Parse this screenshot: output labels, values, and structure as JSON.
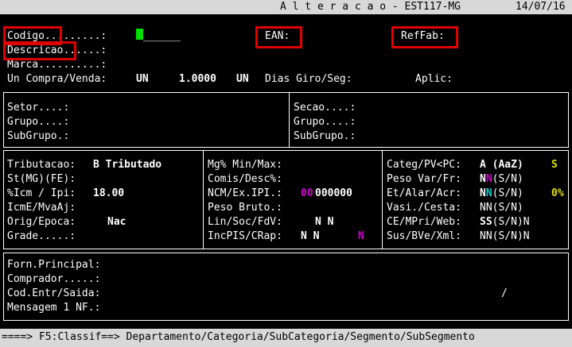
{
  "header": {
    "title": "A l t e r a c a o - EST117-MG",
    "date": "14/07/16"
  },
  "identification": {
    "codigo_label": "Codigo.........:",
    "codigo_input": "______",
    "ean_label": "EAN:",
    "reffab_label": "RefFab:",
    "descricao_label": "Descricao......:",
    "marca_label": "Marca..........:",
    "un_label": "Un Compra/Venda:",
    "un_compra": "UN",
    "fator": "1.0000",
    "un_venda": "UN",
    "dias_giro_label": "Dias Giro/Seg:",
    "aplic_label": "Aplic:"
  },
  "classification": {
    "setor": "Setor....:",
    "grupo": "Grupo....:",
    "subgrupo": "SubGrupo.:",
    "secao": "Secao....:",
    "grupo_right": "Grupo....:",
    "subgrupo_right": "SubGrupo.:"
  },
  "tax": {
    "tributacao_label": "Tributacao:",
    "tributacao_value": "B Tributado",
    "st_label": "St(MG)(FE):",
    "icm_label": "%Icm / Ipi:",
    "icm_value": "18.00",
    "icme_label": "IcmE/MvaAj:",
    "orig_label": "Orig/Epoca:",
    "orig_value": "Nac",
    "grade_label": "Grade.....:"
  },
  "pricing": {
    "mg_label": "Mg% Min/Max:",
    "comis_label": "Comis/Desc%:",
    "ncm_label": "NCM/Ex.IPI.:",
    "ncm_prefix": "00",
    "ncm_rest": "000000",
    "peso_label": "Peso Bruto.:",
    "lin_label": "Lin/Soc/FdV:",
    "lin_value": "N N",
    "inc_label": "IncPIS/CRap:",
    "inc_value": "N N",
    "inc_extra": "N"
  },
  "flags": {
    "categ_label": "Categ/PV<PC:",
    "categ_value": "A (AaZ)",
    "categ_flag": "S",
    "peso_var_label": "Peso Var/Fr:",
    "peso_var_a": "N",
    "peso_var_b": "N",
    "peso_var_opts": "(S/N)",
    "et_label": "Et/Alar/Acr:",
    "et_a": "N",
    "et_b": "N",
    "et_opts": "(S/N)",
    "et_pct": "0%",
    "vasi_label": "Vasi./Cesta:",
    "vasi_value": "NN(S/N)",
    "ce_label": "CE/MPri/Web:",
    "ce_bold": "SS",
    "ce_opts": "(S/N)N",
    "sus_label": "Sus/BVe/Xml:",
    "sus_value": "NN(S/N)N"
  },
  "supplier": {
    "forn_label": "Forn.Principal:",
    "comprador_label": "Comprador.....:",
    "cod_label": "Cod.Entr/Saida:",
    "slash": "/",
    "mensagem_label": "Mensagem 1 NF.:"
  },
  "footer": {
    "text": "====> F5:Classif==> Departamento/Categoria/SubCategoria/Segmento/SubSegmento"
  }
}
